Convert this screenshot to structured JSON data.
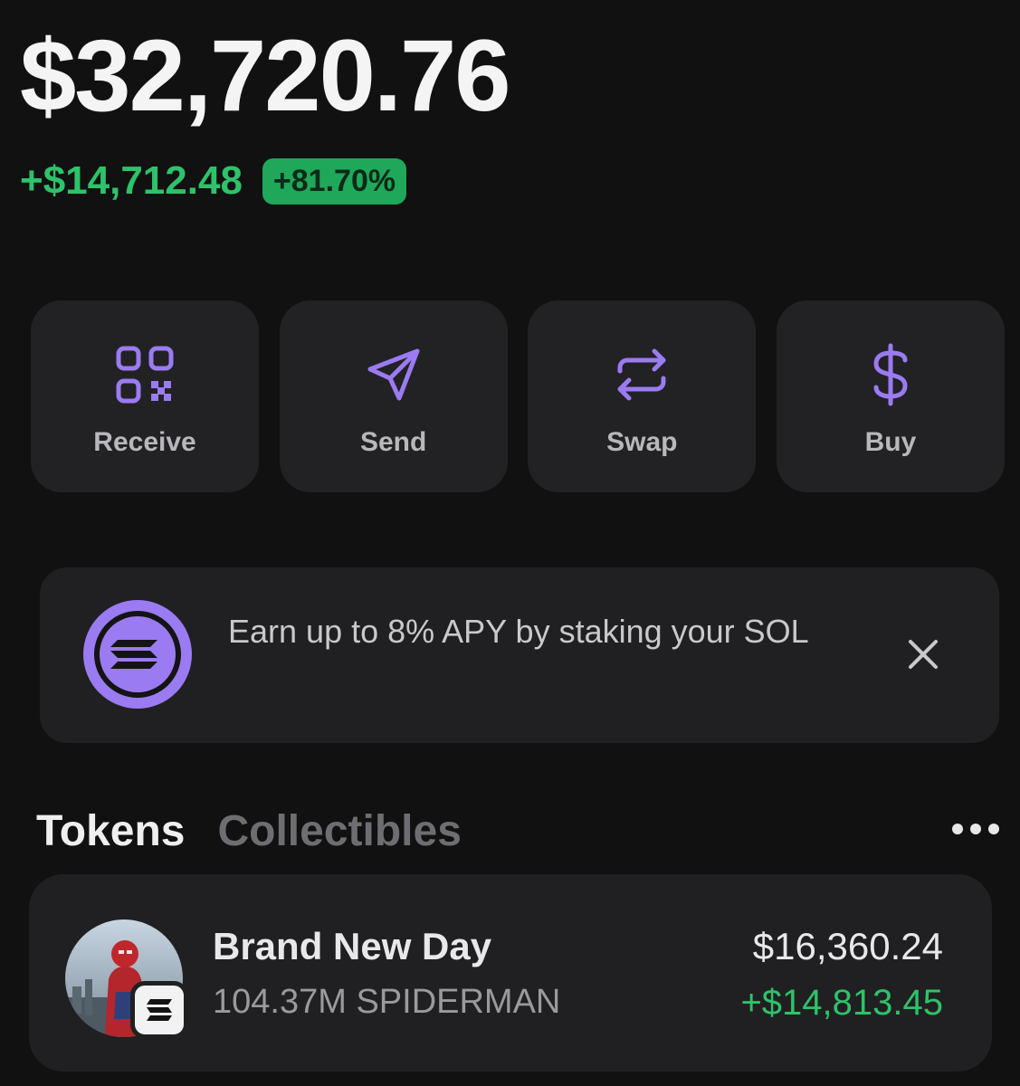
{
  "portfolio": {
    "balance": "$32,720.76",
    "change_amount": "+$14,712.48",
    "change_percent": "+81.70%"
  },
  "actions": [
    {
      "label": "Receive",
      "icon": "qr-code-icon"
    },
    {
      "label": "Send",
      "icon": "send-arrow-icon"
    },
    {
      "label": "Swap",
      "icon": "swap-arrows-icon"
    },
    {
      "label": "Buy",
      "icon": "dollar-icon"
    }
  ],
  "promo": {
    "icon": "solana-logo-icon",
    "text": "Earn up to 8% APY by staking your SOL",
    "close_icon": "close-icon"
  },
  "tabs": [
    {
      "label": "Tokens",
      "active": true
    },
    {
      "label": "Collectibles",
      "active": false
    }
  ],
  "more_icon": "more-dots-icon",
  "tokens": [
    {
      "name": "Brand New Day",
      "amount": "104.37M SPIDERMAN",
      "value": "$16,360.24",
      "change": "+$14,813.45",
      "avatar_icon": "token-avatar-image",
      "chain_badge_icon": "solana-badge-icon"
    }
  ],
  "colors": {
    "background": "#111111",
    "card": "#222224",
    "accent_purple": "#9b7bf2",
    "positive_green": "#2ec26a",
    "badge_green": "#1fa85a"
  }
}
